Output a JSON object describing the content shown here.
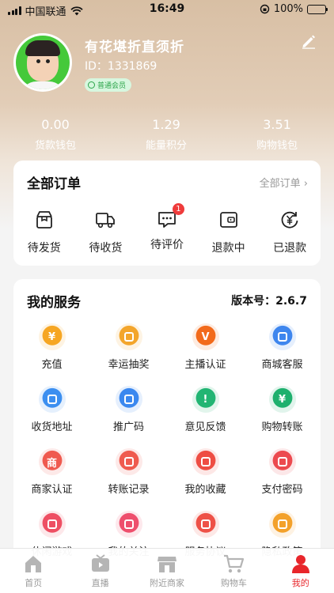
{
  "status_bar": {
    "carrier": "中国联通",
    "time": "16:49",
    "battery": "100%",
    "battery_level": 1.0
  },
  "profile": {
    "name": "有花堪折直须折",
    "id_text": "ID：1331869",
    "member_badge": "普通会员"
  },
  "stats": [
    {
      "value": "0.00",
      "label": "货款钱包"
    },
    {
      "value": "1.29",
      "label": "能量积分"
    },
    {
      "value": "3.51",
      "label": "购物钱包"
    }
  ],
  "orders": {
    "title": "全部订单",
    "more": "全部订单 ›",
    "items": [
      {
        "label": "待发货",
        "icon": "package-icon"
      },
      {
        "label": "待收货",
        "icon": "truck-icon"
      },
      {
        "label": "待评价",
        "icon": "comment-icon",
        "badge": "1"
      },
      {
        "label": "退款中",
        "icon": "wallet-icon"
      },
      {
        "label": "已退款",
        "icon": "refund-icon"
      }
    ]
  },
  "services": {
    "title": "我的服务",
    "version": "版本号：2.6.7",
    "items": [
      {
        "label": "充值",
        "icon": "yen-coin-icon",
        "color": "#f6a623",
        "glyph": "¥"
      },
      {
        "label": "幸运抽奖",
        "icon": "ticket-icon",
        "color": "#f3a52b",
        "glyph": ""
      },
      {
        "label": "主播认证",
        "icon": "badge-v-icon",
        "color": "#f26a1b",
        "glyph": "V"
      },
      {
        "label": "商城客服",
        "icon": "headset-icon",
        "color": "#3e86ee",
        "glyph": ""
      },
      {
        "label": "收货地址",
        "icon": "location-pin-icon",
        "color": "#3c8ff0",
        "glyph": ""
      },
      {
        "label": "推广码",
        "icon": "qr-code-icon",
        "color": "#3b88ef",
        "glyph": ""
      },
      {
        "label": "意见反馈",
        "icon": "feedback-icon",
        "color": "#22b573",
        "glyph": "!"
      },
      {
        "label": "购物转账",
        "icon": "transfer-icon",
        "color": "#1fb06e",
        "glyph": "¥"
      },
      {
        "label": "商家认证",
        "icon": "shop-badge-icon",
        "color": "#ef5a4f",
        "glyph": "商"
      },
      {
        "label": "转账记录",
        "icon": "record-icon",
        "color": "#ef5b4f",
        "glyph": ""
      },
      {
        "label": "我的收藏",
        "icon": "star-icon",
        "color": "#ee4d43",
        "glyph": ""
      },
      {
        "label": "支付密码",
        "icon": "lock-bag-icon",
        "color": "#ec4a4f",
        "glyph": ""
      },
      {
        "label": "休闲游戏",
        "icon": "gamepad-icon",
        "color": "#ee4f63",
        "glyph": ""
      },
      {
        "label": "我的关注",
        "icon": "heart-icon",
        "color": "#ee4f6d",
        "glyph": ""
      },
      {
        "label": "服务协议",
        "icon": "agreement-icon",
        "color": "#ee5147",
        "glyph": ""
      },
      {
        "label": "隐私政策",
        "icon": "privacy-doc-icon",
        "color": "#f3a12b",
        "glyph": ""
      }
    ]
  },
  "tabbar": [
    {
      "label": "首页",
      "icon": "home-icon"
    },
    {
      "label": "直播",
      "icon": "live-tv-icon"
    },
    {
      "label": "附近商家",
      "icon": "store-icon"
    },
    {
      "label": "购物车",
      "icon": "cart-icon"
    },
    {
      "label": "我的",
      "icon": "user-icon",
      "active": true
    }
  ]
}
